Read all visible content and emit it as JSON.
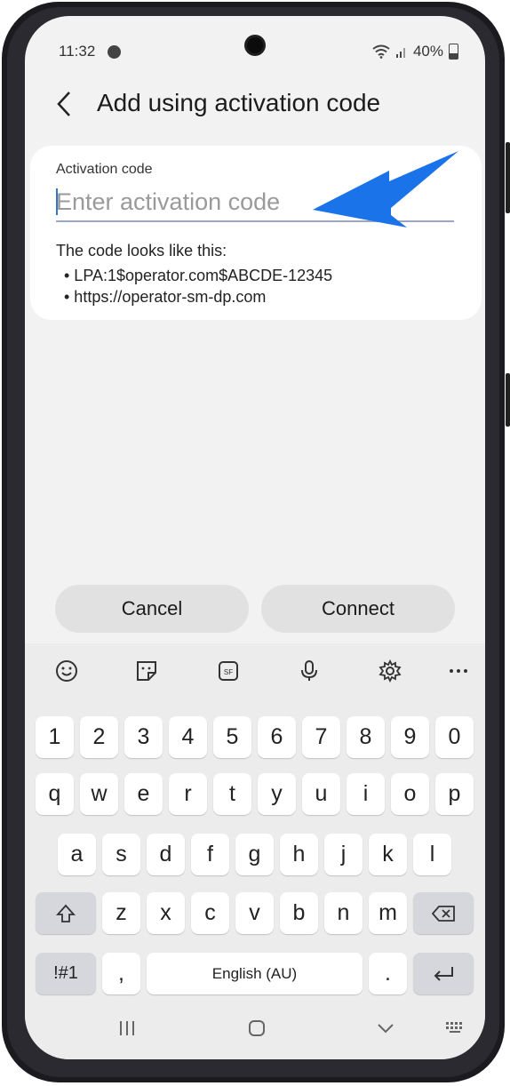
{
  "status_bar": {
    "time": "11:32",
    "battery": "40%"
  },
  "header": {
    "title": "Add using activation code"
  },
  "activation_field": {
    "label": "Activation code",
    "placeholder": "Enter activation code"
  },
  "hint": {
    "title": "The code looks like this:",
    "items": [
      "• LPA:1$operator.com$ABCDE-12345",
      "• https://operator-sm-dp.com"
    ]
  },
  "buttons": {
    "cancel": "Cancel",
    "connect": "Connect"
  },
  "keyboard": {
    "toolbar": [
      "emoji-icon",
      "sticker-icon",
      "gif-icon",
      "microphone-icon",
      "gear-icon",
      "more-icon"
    ],
    "row_numbers": [
      "1",
      "2",
      "3",
      "4",
      "5",
      "6",
      "7",
      "8",
      "9",
      "0"
    ],
    "row_top": [
      "q",
      "w",
      "e",
      "r",
      "t",
      "y",
      "u",
      "i",
      "o",
      "p"
    ],
    "row_middle": [
      "a",
      "s",
      "d",
      "f",
      "g",
      "h",
      "j",
      "k",
      "l"
    ],
    "row_bottom": [
      "z",
      "x",
      "c",
      "v",
      "b",
      "n",
      "m"
    ],
    "symbols_key": "!#1",
    "comma_key": ",",
    "space_label": "English (AU)",
    "period_key": "."
  },
  "accent_color": "#1a73e8"
}
